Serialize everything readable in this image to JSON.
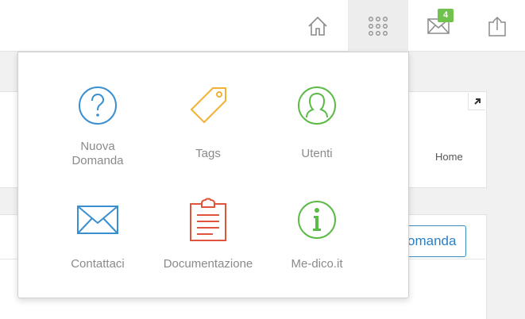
{
  "topbar": {
    "home_icon": "home-icon",
    "apps_icon": "grid-icon",
    "mail_icon": "envelope-icon",
    "mail_badge": "4",
    "upload_icon": "upload-icon"
  },
  "background": {
    "breadcrumb_home": "Home",
    "ask_button_partial": "omanda"
  },
  "menu": {
    "items": [
      {
        "line1": "Nuova",
        "line2": "Domanda",
        "icon": "question-circle-icon",
        "color": "#3a8fd0"
      },
      {
        "line1": "Tags",
        "line2": "",
        "icon": "tag-icon",
        "color": "#f2b134"
      },
      {
        "line1": "Utenti",
        "line2": "",
        "icon": "user-circle-icon",
        "color": "#5cba47"
      },
      {
        "line1": "Contattaci",
        "line2": "",
        "icon": "envelope-icon",
        "color": "#3a8fd0"
      },
      {
        "line1": "Documentazione",
        "line2": "",
        "icon": "clipboard-icon",
        "color": "#e0533d"
      },
      {
        "line1": "Me-dico.it",
        "line2": "",
        "icon": "info-circle-icon",
        "color": "#5cba47"
      }
    ]
  }
}
